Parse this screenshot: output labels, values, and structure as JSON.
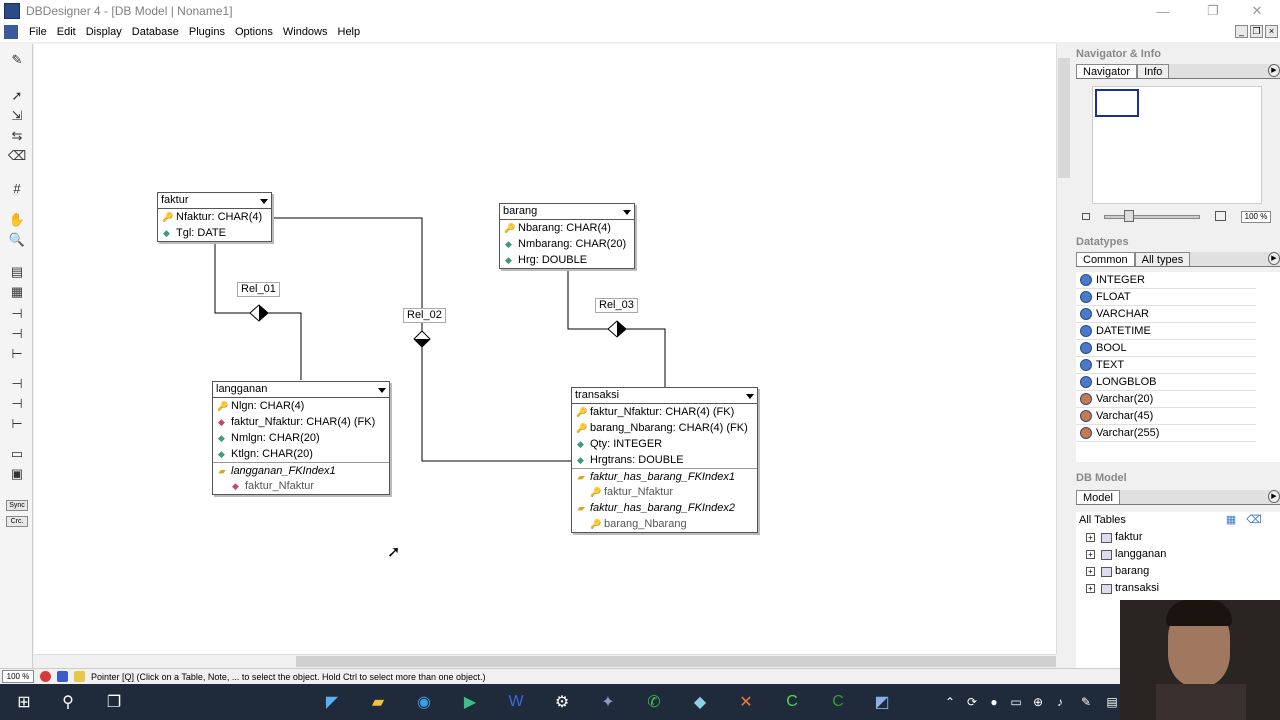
{
  "window": {
    "title": "DBDesigner 4 - [DB Model | Noname1]"
  },
  "menu": [
    "File",
    "Edit",
    "Display",
    "Database",
    "Plugins",
    "Options",
    "Windows",
    "Help"
  ],
  "toolbar": {
    "sync_label": "Sync",
    "crc_label": "Crc."
  },
  "tables": [
    {
      "name": "faktur",
      "columns": [
        {
          "label": "Nfaktur: CHAR(4)",
          "kind": "key"
        },
        {
          "label": "Tgl: DATE",
          "kind": "attr"
        }
      ],
      "indexes": []
    },
    {
      "name": "barang",
      "columns": [
        {
          "label": "Nbarang: CHAR(4)",
          "kind": "key"
        },
        {
          "label": "Nmbarang: CHAR(20)",
          "kind": "attr"
        },
        {
          "label": "Hrg: DOUBLE",
          "kind": "attr"
        }
      ],
      "indexes": []
    },
    {
      "name": "langganan",
      "columns": [
        {
          "label": "Nlgn: CHAR(4)",
          "kind": "key"
        },
        {
          "label": "faktur_Nfaktur: CHAR(4) (FK)",
          "kind": "fk"
        },
        {
          "label": "Nmlgn: CHAR(20)",
          "kind": "attr"
        },
        {
          "label": "Ktlgn: CHAR(20)",
          "kind": "attr"
        }
      ],
      "indexes": [
        {
          "label": "langganan_FKIndex1",
          "fields": [
            "faktur_Nfaktur"
          ]
        }
      ]
    },
    {
      "name": "transaksi",
      "columns": [
        {
          "label": "faktur_Nfaktur: CHAR(4) (FK)",
          "kind": "key"
        },
        {
          "label": "barang_Nbarang: CHAR(4) (FK)",
          "kind": "key"
        },
        {
          "label": "Qty: INTEGER",
          "kind": "attr"
        },
        {
          "label": "Hrgtrans: DOUBLE",
          "kind": "attr"
        }
      ],
      "indexes": [
        {
          "label": "faktur_has_barang_FKIndex1",
          "fields": [
            "faktur_Nfaktur"
          ]
        },
        {
          "label": "faktur_has_barang_FKIndex2",
          "fields": [
            "barang_Nbarang"
          ]
        }
      ]
    }
  ],
  "relations": [
    "Rel_01",
    "Rel_02",
    "Rel_03"
  ],
  "navigator": {
    "header": "Navigator & Info",
    "tabs": [
      "Navigator",
      "Info"
    ],
    "zoom": "100 %"
  },
  "datatypes": {
    "header": "Datatypes",
    "tabs": [
      "Common",
      "All types"
    ],
    "items": [
      "INTEGER",
      "FLOAT",
      "VARCHAR",
      "DATETIME",
      "BOOL",
      "TEXT",
      "LONGBLOB",
      "Varchar(20)",
      "Varchar(45)",
      "Varchar(255)"
    ]
  },
  "dbmodel": {
    "header": "DB Model",
    "tab": "Model",
    "root": "All Tables",
    "tables": [
      "faktur",
      "langganan",
      "barang",
      "transaksi"
    ]
  },
  "status": {
    "zoom": "100 %",
    "text": "Pointer [Q] (Click on a Table, Note, ... to select the object. Hold Ctrl to select more than one object.)"
  }
}
